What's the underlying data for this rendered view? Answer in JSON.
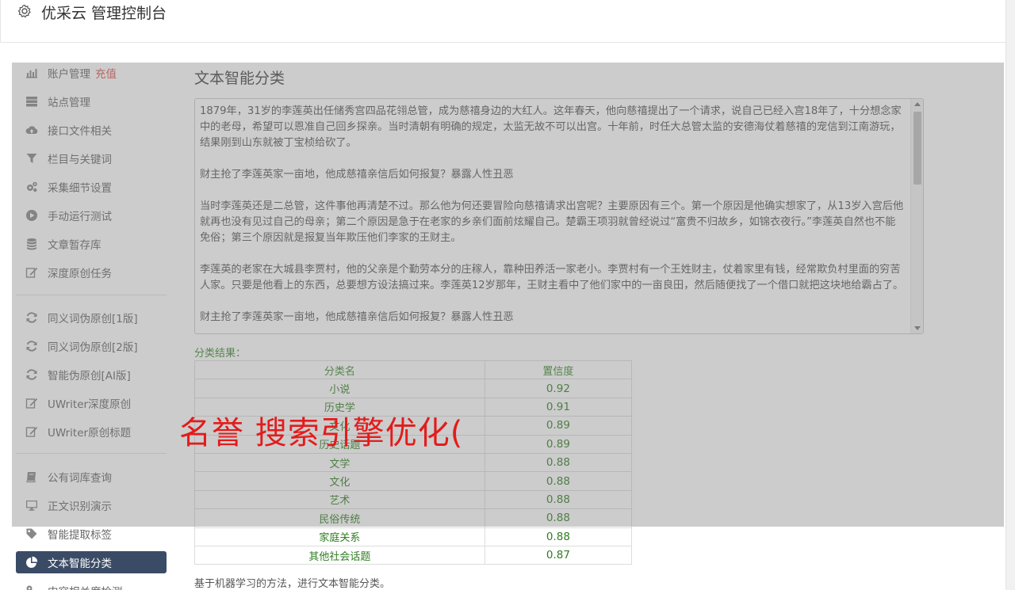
{
  "header": {
    "title": "优采云 管理控制台"
  },
  "sidebar": {
    "items": [
      {
        "label": "账户管理",
        "badge": "充值",
        "icon": "bar-chart-icon"
      },
      {
        "label": "站点管理",
        "icon": "server-icon"
      },
      {
        "label": "接口文件相关",
        "icon": "cloud-upload-icon"
      },
      {
        "label": "栏目与关键词",
        "icon": "filter-icon"
      },
      {
        "label": "采集细节设置",
        "icon": "cogs-icon"
      },
      {
        "label": "手动运行测试",
        "icon": "play-icon"
      },
      {
        "label": "文章暂存库",
        "icon": "database-icon"
      },
      {
        "label": "深度原创任务",
        "icon": "edit-icon"
      },
      {
        "label": "同义词伪原创[1版]",
        "icon": "refresh-icon"
      },
      {
        "label": "同义词伪原创[2版]",
        "icon": "refresh-icon"
      },
      {
        "label": "智能伪原创[AI版]",
        "icon": "refresh-icon"
      },
      {
        "label": "UWriter深度原创",
        "icon": "edit-icon"
      },
      {
        "label": "UWriter原创标题",
        "icon": "edit-icon"
      },
      {
        "label": "公有词库查询",
        "icon": "book-icon"
      },
      {
        "label": "正文识别演示",
        "icon": "desktop-icon"
      },
      {
        "label": "智能提取标签",
        "icon": "tag-icon"
      },
      {
        "label": "文本智能分类",
        "icon": "pie-chart-icon",
        "active": true
      },
      {
        "label": "内容相关度检测",
        "icon": "key-icon"
      }
    ]
  },
  "main": {
    "title": "文本智能分类",
    "text_paragraphs": [
      "1879年，31岁的李莲英出任储秀宫四品花翎总管，成为慈禧身边的大红人。这年春天，他向慈禧提出了一个请求，说自己已经入宫18年了，十分想念家中的老母，希望可以恩准自己回乡探亲。当时清朝有明确的规定，太监无故不可以出宫。十年前，时任大总管太监的安德海仗着慈禧的宠信到江南游玩，结果刚到山东就被丁宝桢给砍了。",
      "财主抢了李莲英家一亩地，他成慈禧亲信后如何报复？暴露人性丑恶",
      "当时李莲英还是二总管，这件事他再清楚不过。那么他为何还要冒险向慈禧请求出宫呢？主要原因有三个。第一个原因是他确实想家了，从13岁入宫后他就再也没有见过自己的母亲；第二个原因是急于在老家的乡亲们面前炫耀自己。楚霸王项羽就曾经说过“富贵不归故乡，如锦衣夜行。”李莲英自然也不能免俗；第三个原因就是报复当年欺压他们李家的王财主。",
      "李莲英的老家在大城县李贾村，他的父亲是个勤劳本分的庄稼人，靠种田养活一家老小。李贾村有一个王姓财主，仗着家里有钱，经常欺负村里面的穷苦人家。只要是他看上的东西，总要想方设法搞过来。李莲英12岁那年，王财主看中了他们家中的一亩良田，然后随便找了一个借口就把这块地给霸占了。",
      "财主抢了李莲英家一亩地，他成慈禧亲信后如何报复？暴露人性丑恶"
    ],
    "result_label": "分类结果：",
    "table": {
      "headers": [
        "分类名",
        "置信度"
      ],
      "rows": [
        [
          "小说",
          "0.92"
        ],
        [
          "历史学",
          "0.91"
        ],
        [
          "文化",
          "0.89"
        ],
        [
          "历史话题",
          "0.89"
        ],
        [
          "文学",
          "0.88"
        ],
        [
          "文化",
          "0.88"
        ],
        [
          "艺术",
          "0.88"
        ],
        [
          "民俗传统",
          "0.88"
        ],
        [
          "家庭关系",
          "0.88"
        ],
        [
          "其他社会话题",
          "0.87"
        ]
      ]
    },
    "footer_note": "基于机器学习的方法，进行文本智能分类。"
  },
  "watermark": "名誉 搜索引擎优化("
}
